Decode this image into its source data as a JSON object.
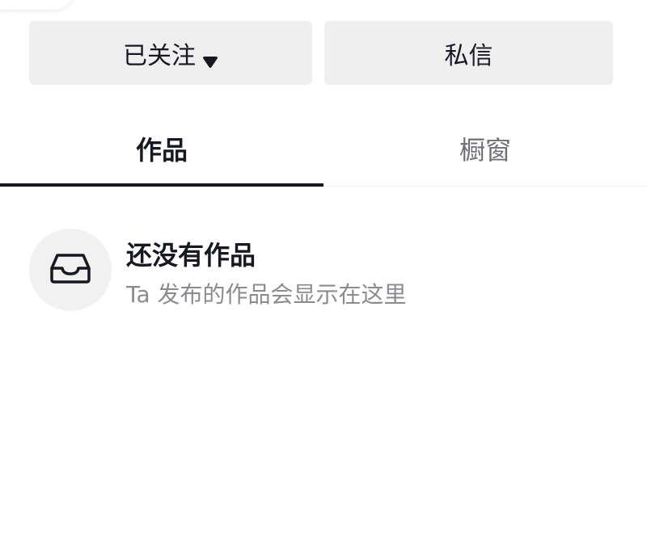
{
  "actions": {
    "follow_label": "已关注",
    "follow_caret_icon": "caret-down-icon",
    "message_label": "私信"
  },
  "tabs": [
    {
      "label": "作品",
      "active": true
    },
    {
      "label": "橱窗",
      "active": false
    }
  ],
  "empty_state": {
    "icon": "inbox-tray-icon",
    "title": "还没有作品",
    "subtitle": "Ta 发布的作品会显示在这里"
  },
  "colors": {
    "button_bg": "#efeff0",
    "text_primary": "#161823",
    "text_secondary": "#8a8b91",
    "tab_inactive": "#6f7077",
    "indicator": "#161823"
  }
}
